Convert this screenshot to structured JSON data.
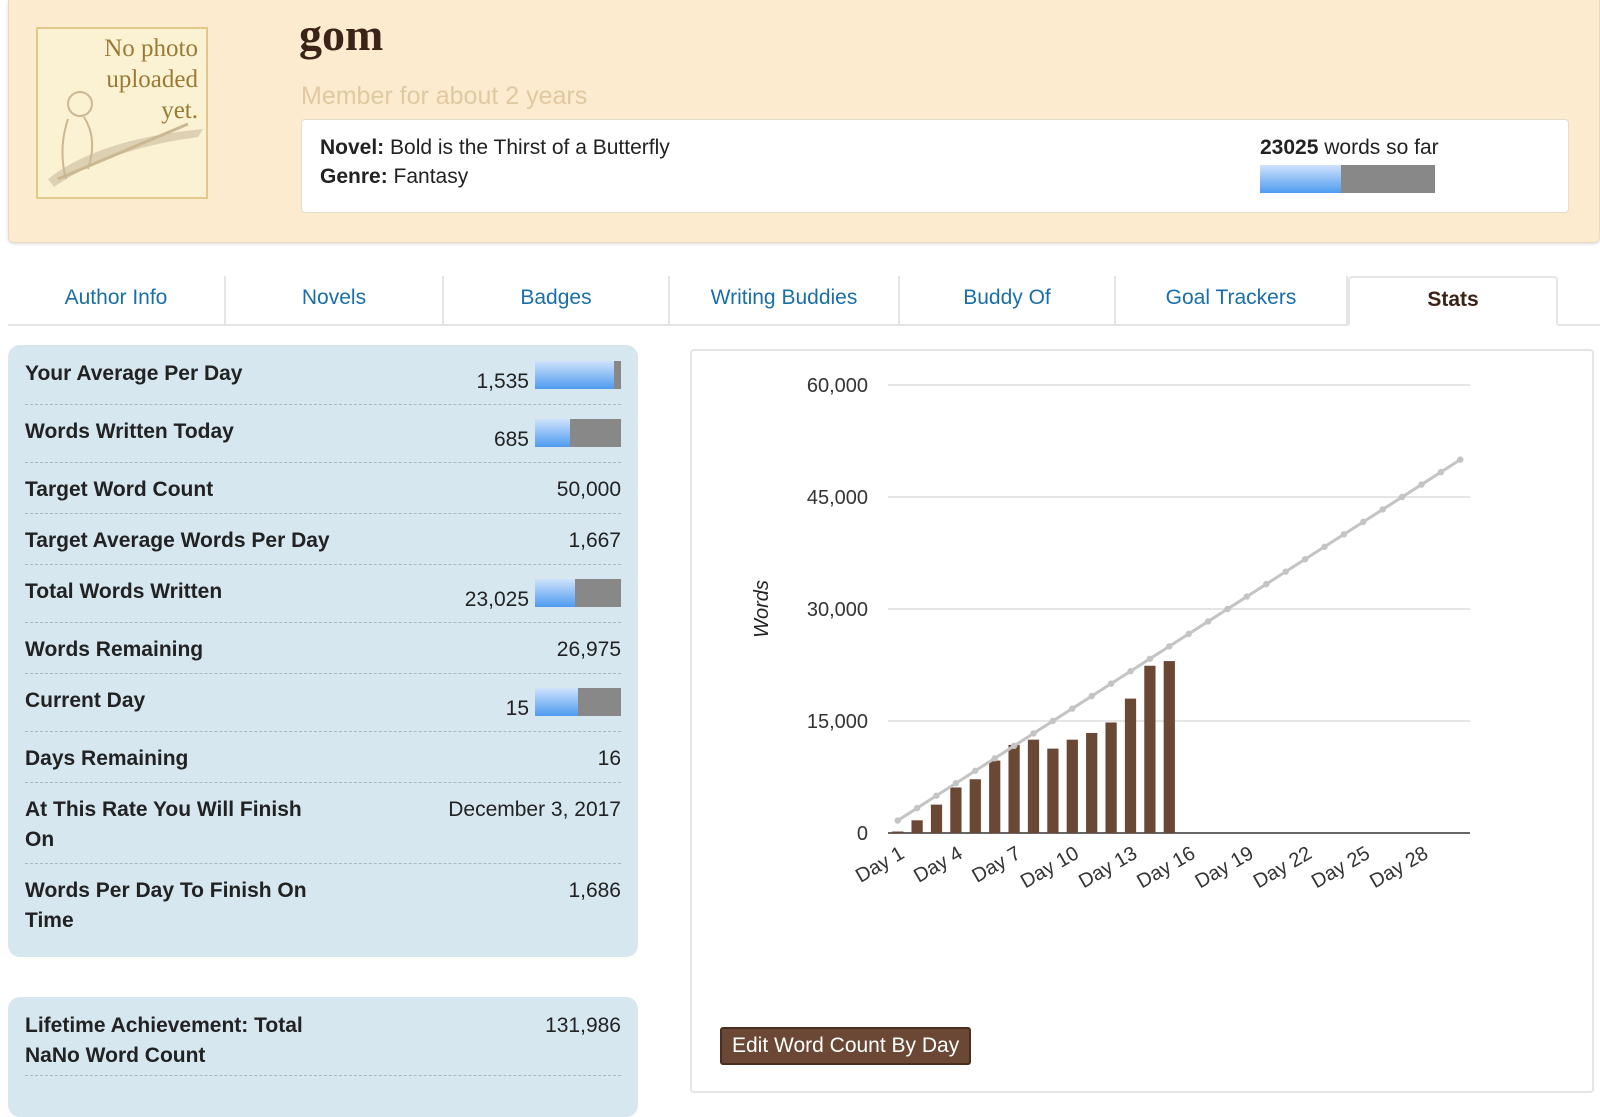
{
  "profile": {
    "photo_placeholder": "No photo uploaded yet.",
    "username": "gom",
    "member_since": "Member for about 2 years",
    "novel_label": "Novel:",
    "novel_title": "Bold is the Thirst of a Butterfly",
    "genre_label": "Genre:",
    "genre": "Fantasy",
    "words_count": "23025",
    "words_suffix": "words so far",
    "progress_fraction": 0.46
  },
  "tabs": [
    {
      "label": "Author Info"
    },
    {
      "label": "Novels"
    },
    {
      "label": "Badges"
    },
    {
      "label": "Writing Buddies"
    },
    {
      "label": "Buddy Of"
    },
    {
      "label": "Goal Trackers"
    },
    {
      "label": "Stats",
      "active": true
    }
  ],
  "stats": [
    {
      "label": "Your Average Per Day",
      "value": "1,535",
      "bar_fraction": 0.92
    },
    {
      "label": "Words Written Today",
      "value": "685",
      "bar_fraction": 0.41
    },
    {
      "label": "Target Word Count",
      "value": "50,000"
    },
    {
      "label": "Target Average Words Per Day",
      "value": "1,667"
    },
    {
      "label": "Total Words Written",
      "value": "23,025",
      "bar_fraction": 0.46
    },
    {
      "label": "Words Remaining",
      "value": "26,975"
    },
    {
      "label": "Current Day",
      "value": "15",
      "bar_fraction": 0.5
    },
    {
      "label": "Days Remaining",
      "value": "16"
    },
    {
      "label": "At This Rate You Will Finish On",
      "value": "December 3, 2017"
    },
    {
      "label": "Words Per Day To Finish On Time",
      "value": "1,686"
    }
  ],
  "lifetime": {
    "label": "Lifetime Achievement: Total NaNo Word Count",
    "value": "131,986"
  },
  "chart_data": {
    "type": "bar",
    "ylabel": "Words",
    "xlabel": "",
    "ylim": [
      0,
      60000
    ],
    "yticks": [
      0,
      15000,
      30000,
      45000,
      60000
    ],
    "ytick_labels": [
      "0",
      "15,000",
      "30,000",
      "45,000",
      "60,000"
    ],
    "xtick_labels": [
      "Day 1",
      "Day 4",
      "Day 7",
      "Day 10",
      "Day 13",
      "Day 16",
      "Day 19",
      "Day 22",
      "Day 25",
      "Day 28"
    ],
    "days": 30,
    "series": [
      {
        "type": "bar",
        "values": [
          200,
          1700,
          3800,
          6100,
          7200,
          9700,
          11800,
          12500,
          11300,
          12500,
          13400,
          14800,
          18000,
          22400,
          23025
        ]
      },
      {
        "type": "line",
        "values": [
          1667,
          3333,
          5000,
          6667,
          8333,
          10000,
          11667,
          13333,
          15000,
          16667,
          18333,
          20000,
          21667,
          23333,
          25000,
          26667,
          28333,
          30000,
          31667,
          33333,
          35000,
          36667,
          38333,
          40000,
          41667,
          43333,
          45000,
          46667,
          48333,
          50000
        ]
      }
    ],
    "bar_color": "#6b4835",
    "line_color": "#c4c4c4",
    "grid": true,
    "legend": "none"
  },
  "edit_button_label": "Edit Word Count By Day",
  "colors": {
    "header_bg": "#fdebd0",
    "stats_bg": "#d6e7f0",
    "tab_link": "#1a6fa8",
    "brown": "#6b4835"
  }
}
